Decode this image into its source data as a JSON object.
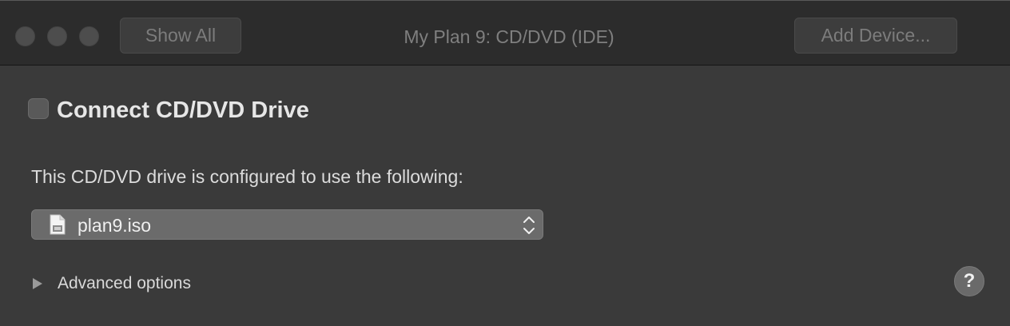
{
  "titlebar": {
    "title": "My Plan 9: CD/DVD (IDE)",
    "show_all_label": "Show All",
    "add_device_label": "Add Device..."
  },
  "settings": {
    "connect_label": "Connect CD/DVD Drive",
    "connect_checked": false,
    "description": "This CD/DVD drive is configured to use the following:",
    "source_selected": "plan9.iso",
    "source_icon": "iso-file-icon",
    "advanced_label": "Advanced options",
    "help_label": "?"
  },
  "colors": {
    "window_bg": "#3a3a3a",
    "titlebar_bg": "#2c2c2c",
    "popup_bg": "#6b6b6b"
  }
}
